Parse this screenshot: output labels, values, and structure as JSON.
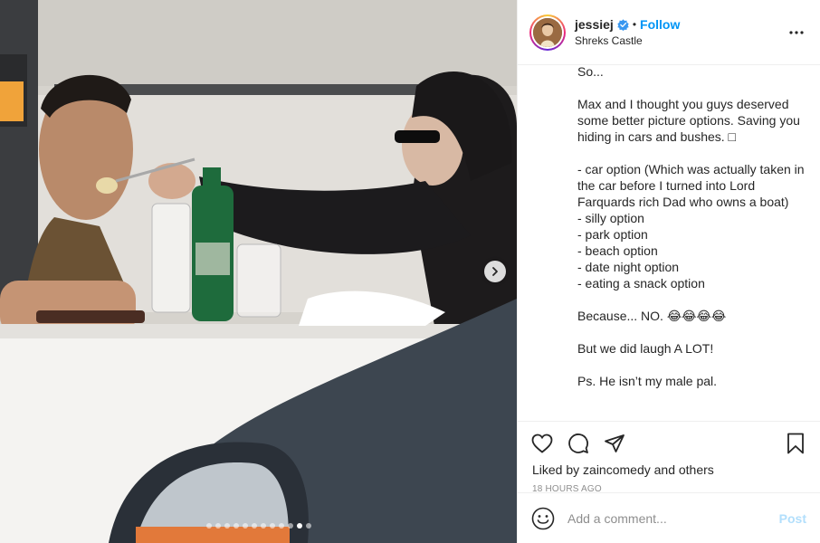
{
  "post": {
    "username": "jessiej",
    "separator": "•",
    "follow_label": "Follow",
    "location": "Shreks Castle",
    "more_icon": "more-horizontal-icon",
    "caption_lines": [
      "So...",
      "",
      "Max and I thought you guys deserved some better picture options. Saving you hiding in cars and bushes. □",
      "",
      "- car option (Which was actually taken in the car before I turned into Lord Farquards rich Dad who owns a boat)",
      "- silly option",
      "- park option",
      "- beach option",
      "- date night option",
      "- eating a snack option",
      "",
      "Because... NO. 😂😂😂😂",
      "",
      "But we did laugh A LOT!",
      "",
      "Ps. He isn’t my male pal."
    ],
    "likes_text": "Liked by zaincomedy and others",
    "timestamp": "18 HOURS AGO",
    "comment_placeholder": "Add a comment...",
    "post_label": "Post"
  },
  "carousel": {
    "slide_count": 12,
    "active_index": 10
  },
  "colors": {
    "link_blue": "#0095f6",
    "post_disabled": "#b2dffc",
    "muted_text": "#8e8e8e",
    "border": "#efefef"
  },
  "icons": [
    "verified-badge-icon",
    "heart-icon",
    "comment-icon",
    "share-icon",
    "bookmark-icon",
    "emoji-icon",
    "chevron-right-icon"
  ]
}
